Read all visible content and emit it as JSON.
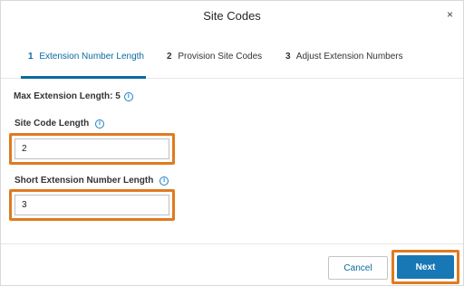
{
  "dialog": {
    "title": "Site Codes",
    "close_glyph": "×"
  },
  "tabs": [
    {
      "number": "1",
      "label": "Extension Number Length",
      "active": true
    },
    {
      "number": "2",
      "label": "Provision Site Codes",
      "active": false
    },
    {
      "number": "3",
      "label": "Adjust Extension Numbers",
      "active": false
    }
  ],
  "form": {
    "max_extension_label": "Max Extension Length:",
    "max_extension_value": "5",
    "site_code_label": "Site Code Length",
    "site_code_value": "2",
    "short_extension_label": "Short Extension Number Length",
    "short_extension_value": "3",
    "info_glyph": "i"
  },
  "footer": {
    "cancel_label": "Cancel",
    "next_label": "Next"
  },
  "colors": {
    "accent": "#0a6aa0",
    "primary_button": "#1877b5",
    "highlight": "#e07b20"
  }
}
